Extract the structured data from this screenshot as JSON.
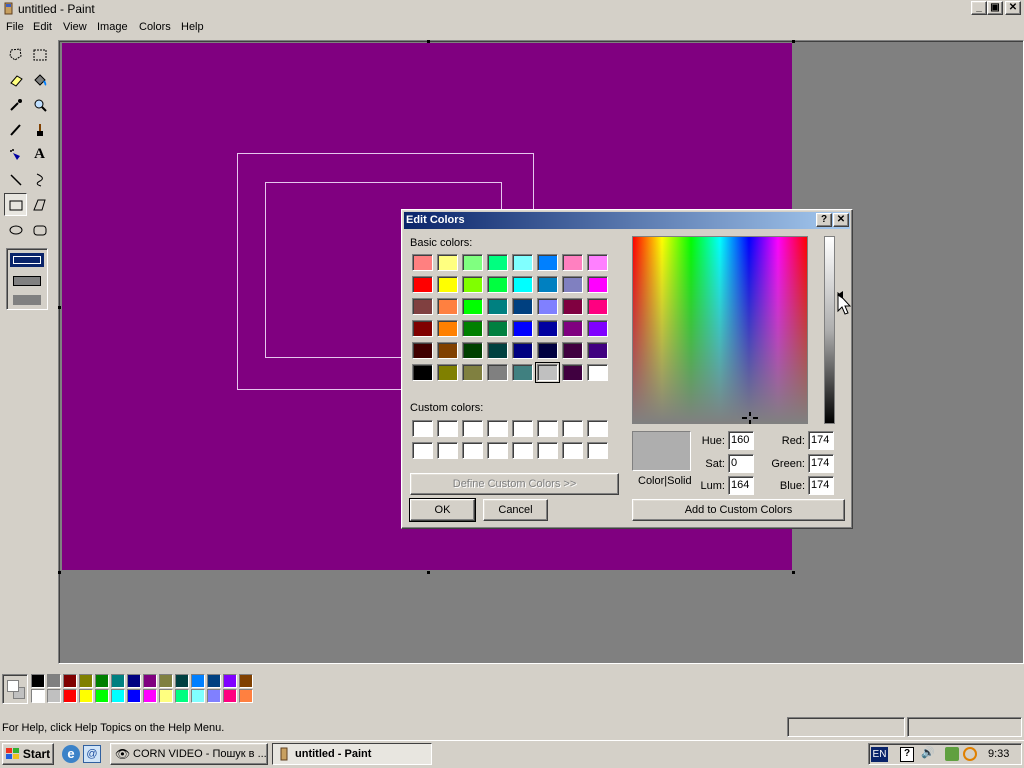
{
  "window": {
    "title": "untitled - Paint",
    "minimize": "_",
    "maximize": "▣",
    "close": "✕"
  },
  "menu": [
    "File",
    "Edit",
    "View",
    "Image",
    "Colors",
    "Help"
  ],
  "toolbox": {
    "tools": [
      "free-form-select",
      "select",
      "eraser",
      "fill-with-color",
      "pick-color",
      "magnifier",
      "pencil",
      "brush",
      "airbrush",
      "text",
      "line",
      "curve",
      "rectangle",
      "polygon",
      "ellipse",
      "rounded-rectangle"
    ],
    "selected": "rectangle"
  },
  "palette": {
    "top_row": [
      "#000000",
      "#808080",
      "#800000",
      "#808000",
      "#008000",
      "#008080",
      "#000080",
      "#800080",
      "#808040",
      "#004040",
      "#0080ff",
      "#004080",
      "#8000ff",
      "#804000"
    ],
    "bottom_row": [
      "#ffffff",
      "#c0c0c0",
      "#ff0000",
      "#ffff00",
      "#00ff00",
      "#00ffff",
      "#0000ff",
      "#ff00ff",
      "#ffff80",
      "#00ff80",
      "#80ffff",
      "#8080ff",
      "#ff0080",
      "#ff8040"
    ],
    "foreground": "#ffffff",
    "background": "#c0c0c0"
  },
  "canvas": {
    "fill": "#800080"
  },
  "status": {
    "help_text": "For Help, click Help Topics on the Help Menu."
  },
  "taskbar": {
    "start": "Start",
    "tasks": [
      {
        "label": "CORN VIDEO - Пошук в ...",
        "active": false
      },
      {
        "label": "untitled - Paint",
        "active": true
      }
    ],
    "tray": {
      "lang": "EN",
      "time": "9:33"
    }
  },
  "dialog": {
    "title": "Edit Colors",
    "help_btn": "?",
    "close_btn": "✕",
    "basic_label": "Basic colors:",
    "basic_colors": [
      [
        "#ff8080",
        "#ffff80",
        "#80ff80",
        "#00ff80",
        "#80ffff",
        "#0080ff",
        "#ff80c0",
        "#ff80ff"
      ],
      [
        "#ff0000",
        "#ffff00",
        "#80ff00",
        "#00ff40",
        "#00ffff",
        "#0080c0",
        "#8080c0",
        "#ff00ff"
      ],
      [
        "#804040",
        "#ff8040",
        "#00ff00",
        "#008080",
        "#004080",
        "#8080ff",
        "#800040",
        "#ff0080"
      ],
      [
        "#800000",
        "#ff8000",
        "#008000",
        "#008040",
        "#0000ff",
        "#0000a0",
        "#800080",
        "#8000ff"
      ],
      [
        "#400000",
        "#804000",
        "#004000",
        "#004040",
        "#000080",
        "#000040",
        "#400040",
        "#400080"
      ],
      [
        "#000000",
        "#808000",
        "#808040",
        "#808080",
        "#408080",
        "#c0c0c0",
        "#400040",
        "#ffffff"
      ]
    ],
    "selected_basic": [
      5,
      5
    ],
    "custom_label": "Custom colors:",
    "define_custom": "Define Custom Colors >>",
    "ok": "OK",
    "cancel": "Cancel",
    "color_solid": "Color|Solid",
    "preview_color": "#aeaeae",
    "hue_label": "Hue:",
    "hue": "160",
    "sat_label": "Sat:",
    "sat": "0",
    "lum_label": "Lum:",
    "lum": "164",
    "red_label": "Red:",
    "red": "174",
    "green_label": "Green:",
    "green": "174",
    "blue_label": "Blue:",
    "blue": "174",
    "add_custom": "Add to Custom Colors"
  }
}
